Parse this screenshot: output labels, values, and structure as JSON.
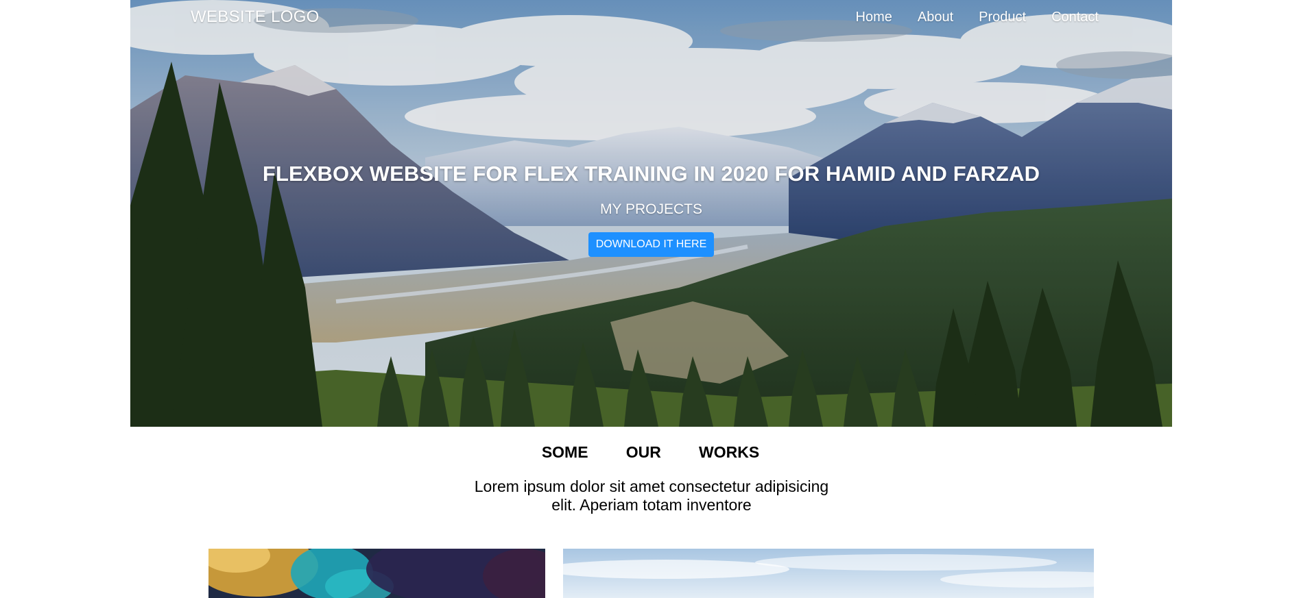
{
  "header": {
    "logo": "WEBSITE LOGO",
    "nav": [
      {
        "label": "Home"
      },
      {
        "label": "About"
      },
      {
        "label": "Product"
      },
      {
        "label": "Contact"
      }
    ]
  },
  "hero": {
    "title": "FLEXBOX WEBSITE FOR FLEX TRAINING IN 2020 FOR HAMID AND FARZAD",
    "subtitle": "MY PROJECTS",
    "cta_label": "DOWNLOAD IT HERE",
    "background": "mountain-landscape-image"
  },
  "works": {
    "heading": "SOME   OUR   WORKS",
    "description": "Lorem ipsum dolor sit amet consectetur adipisicing elit. Aperiam totam inventore"
  },
  "gallery": [
    {
      "image": "abstract-ink-image"
    },
    {
      "image": "sky-landscape-image"
    }
  ],
  "colors": {
    "accent": "#1e90ff",
    "text": "#000000",
    "background": "#ffffff"
  }
}
